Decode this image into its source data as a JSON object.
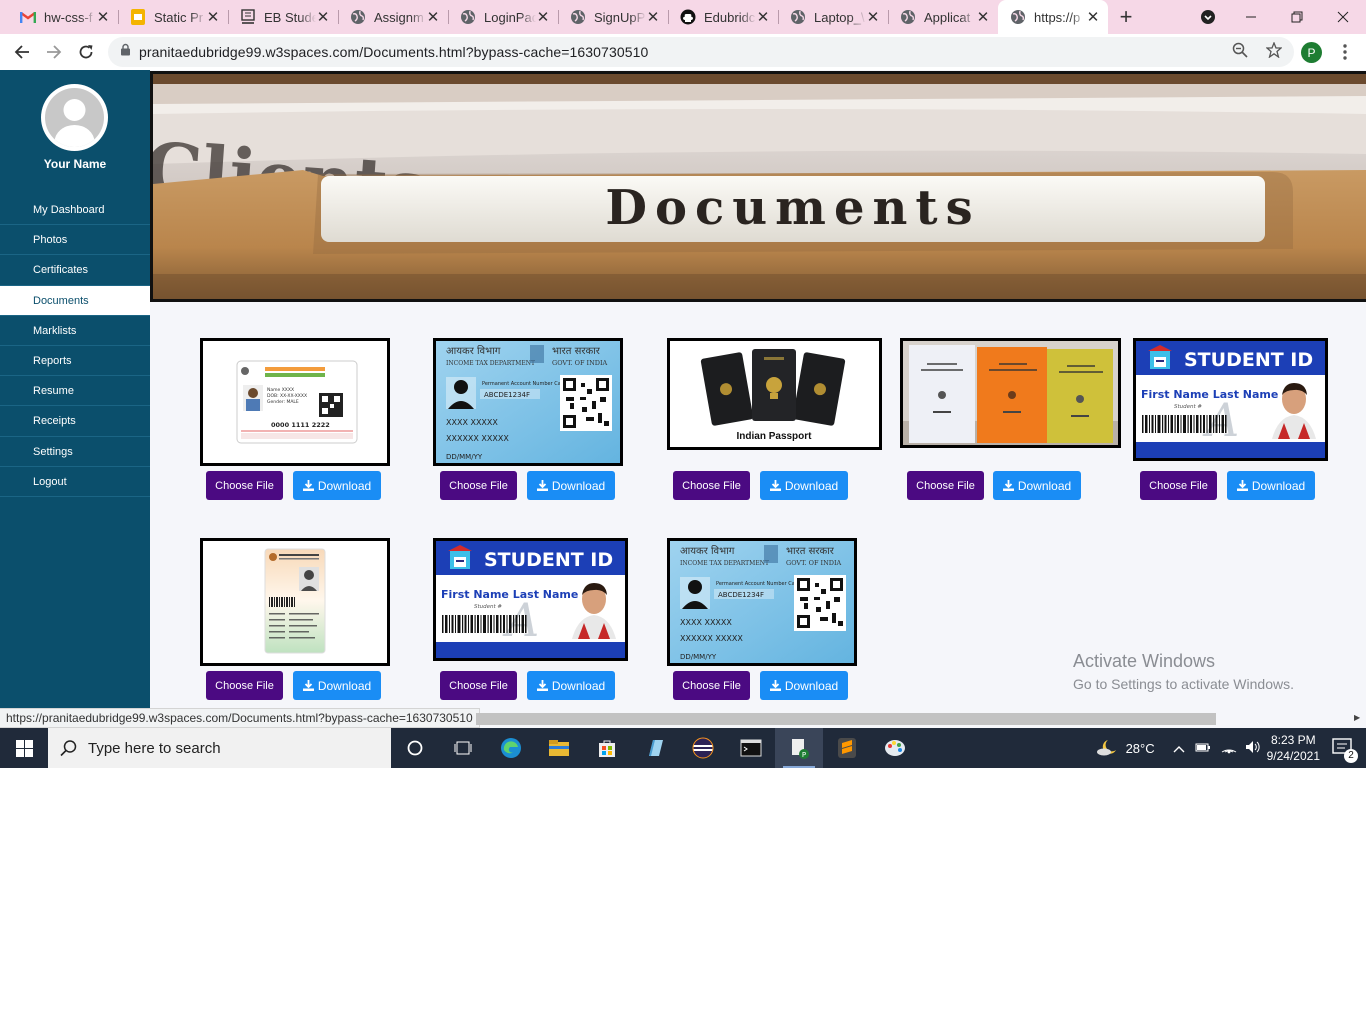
{
  "browser": {
    "tabs": [
      {
        "title": "hw-css-f",
        "icon": "gmail-icon"
      },
      {
        "title": "Static Pr",
        "icon": "slides-icon"
      },
      {
        "title": "EB Stude",
        "icon": "eb-icon"
      },
      {
        "title": "Assignm",
        "icon": "globe-icon"
      },
      {
        "title": "LoginPac",
        "icon": "globe-icon"
      },
      {
        "title": "SignUpP",
        "icon": "globe-icon"
      },
      {
        "title": "Edubridc",
        "icon": "github-icon"
      },
      {
        "title": "Laptop_\\",
        "icon": "globe-icon"
      },
      {
        "title": "Applicat",
        "icon": "globe-icon"
      },
      {
        "title": "https://p",
        "icon": "globe-icon",
        "active": true
      }
    ],
    "url": "pranitaedubridge99.w3spaces.com/Documents.html?bypass-cache=1630730510",
    "profile_initial": "P",
    "status_url": "https://pranitaedubridge99.w3spaces.com/Documents.html?bypass-cache=1630730510"
  },
  "sidebar": {
    "user_name": "Your Name",
    "items": [
      {
        "label": "My Dashboard"
      },
      {
        "label": "Photos"
      },
      {
        "label": "Certificates"
      },
      {
        "label": "Documents",
        "active": true
      },
      {
        "label": "Marklists"
      },
      {
        "label": "Reports"
      },
      {
        "label": "Resume"
      },
      {
        "label": "Receipts"
      },
      {
        "label": "Settings"
      },
      {
        "label": "Logout"
      }
    ]
  },
  "banner": {
    "text": "Documents",
    "back_text": "Clients"
  },
  "documents": [
    {
      "kind": "aadhaar",
      "card_text": [
        "Name XXXX",
        "DOB: XX-XX-XXXX",
        "Gender: MALE",
        "0000 1111 2222"
      ]
    },
    {
      "kind": "pan",
      "card_text": [
        "आयकर विभाग",
        "भारत सरकार",
        "INCOME TAX DEPARTMENT",
        "GOVT. OF INDIA",
        "Permanent Account Number Card",
        "ABCDE1234F",
        "XXXX XXXXX",
        "XXXXXX XXXXX",
        "DD/MM/YY"
      ]
    },
    {
      "kind": "passport",
      "card_text": [
        "Indian Passport"
      ]
    },
    {
      "kind": "books",
      "card_text": []
    },
    {
      "kind": "studentid",
      "card_text": [
        "STUDENT ID",
        "First Name Last Name",
        "Student #"
      ]
    },
    {
      "kind": "voterid",
      "card_text": []
    },
    {
      "kind": "studentid",
      "card_text": [
        "STUDENT ID",
        "First Name Last Name",
        "Student #"
      ]
    },
    {
      "kind": "pan",
      "card_text": [
        "आयकर विभाग",
        "भारत सरकार",
        "INCOME TAX DEPARTMENT",
        "GOVT. OF INDIA",
        "Permanent Account Number Card",
        "ABCDE1234F",
        "XXXX XXXXX",
        "XXXXXX XXXXX",
        "DD/MM/YY"
      ]
    }
  ],
  "buttons": {
    "choose": "Choose File",
    "download": "Download"
  },
  "watermark": {
    "line1": "Activate Windows",
    "line2": "Go to Settings to activate Windows."
  },
  "taskbar": {
    "search_placeholder": "Type here to search",
    "temperature": "28°C",
    "time": "8:23 PM",
    "date": "9/24/2021",
    "notifications": "2"
  },
  "colors": {
    "sidebar": "#0b4f6c",
    "choose_button": "#4b0a82",
    "download_button": "#1a8df5",
    "tab_strip": "#f6d8e7"
  }
}
